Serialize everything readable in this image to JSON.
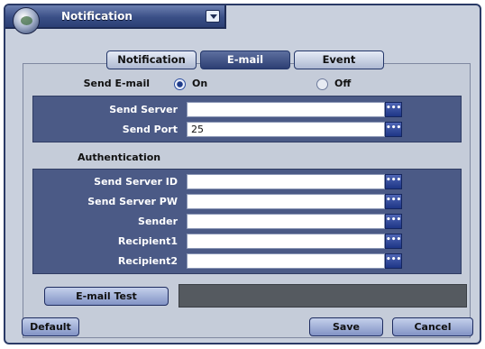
{
  "window": {
    "title": "Notification"
  },
  "tabs": [
    {
      "label": "Notification",
      "active": false
    },
    {
      "label": "E-mail",
      "active": true
    },
    {
      "label": "Event",
      "active": false
    }
  ],
  "send_email": {
    "label": "Send E-mail",
    "on_label": "On",
    "off_label": "Off",
    "selected": "On"
  },
  "server": {
    "send_server_label": "Send Server",
    "send_server_value": "",
    "send_port_label": "Send Port",
    "send_port_value": "25"
  },
  "authentication": {
    "title": "Authentication",
    "fields": [
      {
        "label": "Send Server ID",
        "value": ""
      },
      {
        "label": "Send Server PW",
        "value": ""
      },
      {
        "label": "Sender",
        "value": ""
      },
      {
        "label": "Recipient1",
        "value": ""
      },
      {
        "label": "Recipient2",
        "value": ""
      }
    ]
  },
  "buttons": {
    "email_test": "E-mail Test",
    "default": "Default",
    "save": "Save",
    "cancel": "Cancel",
    "field_button": "•••"
  },
  "colors": {
    "titlebar": "#3a4f86",
    "panel": "#4b5a86",
    "active_tab": "#2d3f73"
  }
}
